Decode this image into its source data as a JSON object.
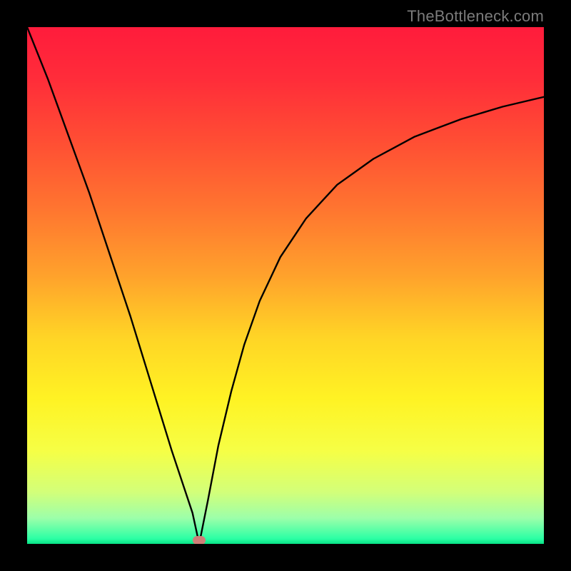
{
  "watermark": {
    "text": "TheBottleneck.com"
  },
  "chart_data": {
    "type": "line",
    "title": "",
    "xlabel": "",
    "ylabel": "",
    "xlim": [
      0,
      1
    ],
    "ylim": [
      0,
      1
    ],
    "grid": false,
    "background_gradient_stops": [
      {
        "offset": 0.0,
        "color": "#ff1c3c"
      },
      {
        "offset": 0.1,
        "color": "#ff2d3a"
      },
      {
        "offset": 0.22,
        "color": "#ff4e34"
      },
      {
        "offset": 0.35,
        "color": "#ff7530"
      },
      {
        "offset": 0.48,
        "color": "#ffa22c"
      },
      {
        "offset": 0.6,
        "color": "#ffd526"
      },
      {
        "offset": 0.72,
        "color": "#fff324"
      },
      {
        "offset": 0.82,
        "color": "#f6ff46"
      },
      {
        "offset": 0.9,
        "color": "#d3ff7a"
      },
      {
        "offset": 0.95,
        "color": "#9dffaa"
      },
      {
        "offset": 0.99,
        "color": "#2cffa5"
      },
      {
        "offset": 1.0,
        "color": "#08e385"
      }
    ],
    "series": [
      {
        "name": "bottleneck-left-branch",
        "stroke": "#000000",
        "stroke_width": 2.4,
        "x": [
          0.0,
          0.04,
          0.08,
          0.12,
          0.16,
          0.2,
          0.24,
          0.28,
          0.32,
          0.333
        ],
        "y": [
          1.0,
          0.9,
          0.79,
          0.68,
          0.56,
          0.44,
          0.31,
          0.18,
          0.06,
          0.0
        ]
      },
      {
        "name": "bottleneck-right-branch",
        "stroke": "#000000",
        "stroke_width": 2.4,
        "x": [
          0.333,
          0.35,
          0.37,
          0.395,
          0.42,
          0.45,
          0.49,
          0.54,
          0.6,
          0.67,
          0.75,
          0.84,
          0.92,
          1.0
        ],
        "y": [
          0.0,
          0.085,
          0.19,
          0.295,
          0.385,
          0.47,
          0.555,
          0.63,
          0.695,
          0.745,
          0.788,
          0.822,
          0.846,
          0.865
        ]
      }
    ],
    "marker": {
      "name": "min-point-marker",
      "x": 0.333,
      "y": 0.007,
      "color": "#cf7f78",
      "shape": "pill"
    }
  }
}
